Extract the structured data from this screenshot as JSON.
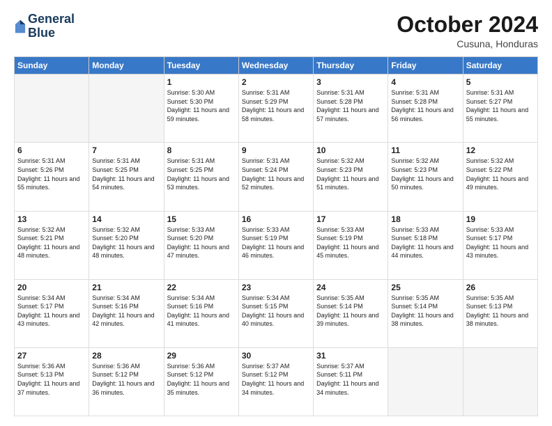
{
  "header": {
    "logo_line1": "General",
    "logo_line2": "Blue",
    "month": "October 2024",
    "location": "Cusuna, Honduras"
  },
  "days_of_week": [
    "Sunday",
    "Monday",
    "Tuesday",
    "Wednesday",
    "Thursday",
    "Friday",
    "Saturday"
  ],
  "weeks": [
    [
      {
        "day": "",
        "empty": true
      },
      {
        "day": "",
        "empty": true
      },
      {
        "day": "1",
        "sunrise": "5:30 AM",
        "sunset": "5:30 PM",
        "daylight": "11 hours and 59 minutes."
      },
      {
        "day": "2",
        "sunrise": "5:31 AM",
        "sunset": "5:29 PM",
        "daylight": "11 hours and 58 minutes."
      },
      {
        "day": "3",
        "sunrise": "5:31 AM",
        "sunset": "5:28 PM",
        "daylight": "11 hours and 57 minutes."
      },
      {
        "day": "4",
        "sunrise": "5:31 AM",
        "sunset": "5:28 PM",
        "daylight": "11 hours and 56 minutes."
      },
      {
        "day": "5",
        "sunrise": "5:31 AM",
        "sunset": "5:27 PM",
        "daylight": "11 hours and 55 minutes."
      }
    ],
    [
      {
        "day": "6",
        "sunrise": "5:31 AM",
        "sunset": "5:26 PM",
        "daylight": "11 hours and 55 minutes."
      },
      {
        "day": "7",
        "sunrise": "5:31 AM",
        "sunset": "5:25 PM",
        "daylight": "11 hours and 54 minutes."
      },
      {
        "day": "8",
        "sunrise": "5:31 AM",
        "sunset": "5:25 PM",
        "daylight": "11 hours and 53 minutes."
      },
      {
        "day": "9",
        "sunrise": "5:31 AM",
        "sunset": "5:24 PM",
        "daylight": "11 hours and 52 minutes."
      },
      {
        "day": "10",
        "sunrise": "5:32 AM",
        "sunset": "5:23 PM",
        "daylight": "11 hours and 51 minutes."
      },
      {
        "day": "11",
        "sunrise": "5:32 AM",
        "sunset": "5:23 PM",
        "daylight": "11 hours and 50 minutes."
      },
      {
        "day": "12",
        "sunrise": "5:32 AM",
        "sunset": "5:22 PM",
        "daylight": "11 hours and 49 minutes."
      }
    ],
    [
      {
        "day": "13",
        "sunrise": "5:32 AM",
        "sunset": "5:21 PM",
        "daylight": "11 hours and 48 minutes."
      },
      {
        "day": "14",
        "sunrise": "5:32 AM",
        "sunset": "5:20 PM",
        "daylight": "11 hours and 48 minutes."
      },
      {
        "day": "15",
        "sunrise": "5:33 AM",
        "sunset": "5:20 PM",
        "daylight": "11 hours and 47 minutes."
      },
      {
        "day": "16",
        "sunrise": "5:33 AM",
        "sunset": "5:19 PM",
        "daylight": "11 hours and 46 minutes."
      },
      {
        "day": "17",
        "sunrise": "5:33 AM",
        "sunset": "5:19 PM",
        "daylight": "11 hours and 45 minutes."
      },
      {
        "day": "18",
        "sunrise": "5:33 AM",
        "sunset": "5:18 PM",
        "daylight": "11 hours and 44 minutes."
      },
      {
        "day": "19",
        "sunrise": "5:33 AM",
        "sunset": "5:17 PM",
        "daylight": "11 hours and 43 minutes."
      }
    ],
    [
      {
        "day": "20",
        "sunrise": "5:34 AM",
        "sunset": "5:17 PM",
        "daylight": "11 hours and 43 minutes."
      },
      {
        "day": "21",
        "sunrise": "5:34 AM",
        "sunset": "5:16 PM",
        "daylight": "11 hours and 42 minutes."
      },
      {
        "day": "22",
        "sunrise": "5:34 AM",
        "sunset": "5:16 PM",
        "daylight": "11 hours and 41 minutes."
      },
      {
        "day": "23",
        "sunrise": "5:34 AM",
        "sunset": "5:15 PM",
        "daylight": "11 hours and 40 minutes."
      },
      {
        "day": "24",
        "sunrise": "5:35 AM",
        "sunset": "5:14 PM",
        "daylight": "11 hours and 39 minutes."
      },
      {
        "day": "25",
        "sunrise": "5:35 AM",
        "sunset": "5:14 PM",
        "daylight": "11 hours and 38 minutes."
      },
      {
        "day": "26",
        "sunrise": "5:35 AM",
        "sunset": "5:13 PM",
        "daylight": "11 hours and 38 minutes."
      }
    ],
    [
      {
        "day": "27",
        "sunrise": "5:36 AM",
        "sunset": "5:13 PM",
        "daylight": "11 hours and 37 minutes."
      },
      {
        "day": "28",
        "sunrise": "5:36 AM",
        "sunset": "5:12 PM",
        "daylight": "11 hours and 36 minutes."
      },
      {
        "day": "29",
        "sunrise": "5:36 AM",
        "sunset": "5:12 PM",
        "daylight": "11 hours and 35 minutes."
      },
      {
        "day": "30",
        "sunrise": "5:37 AM",
        "sunset": "5:12 PM",
        "daylight": "11 hours and 34 minutes."
      },
      {
        "day": "31",
        "sunrise": "5:37 AM",
        "sunset": "5:11 PM",
        "daylight": "11 hours and 34 minutes."
      },
      {
        "day": "",
        "empty": true
      },
      {
        "day": "",
        "empty": true
      }
    ]
  ]
}
